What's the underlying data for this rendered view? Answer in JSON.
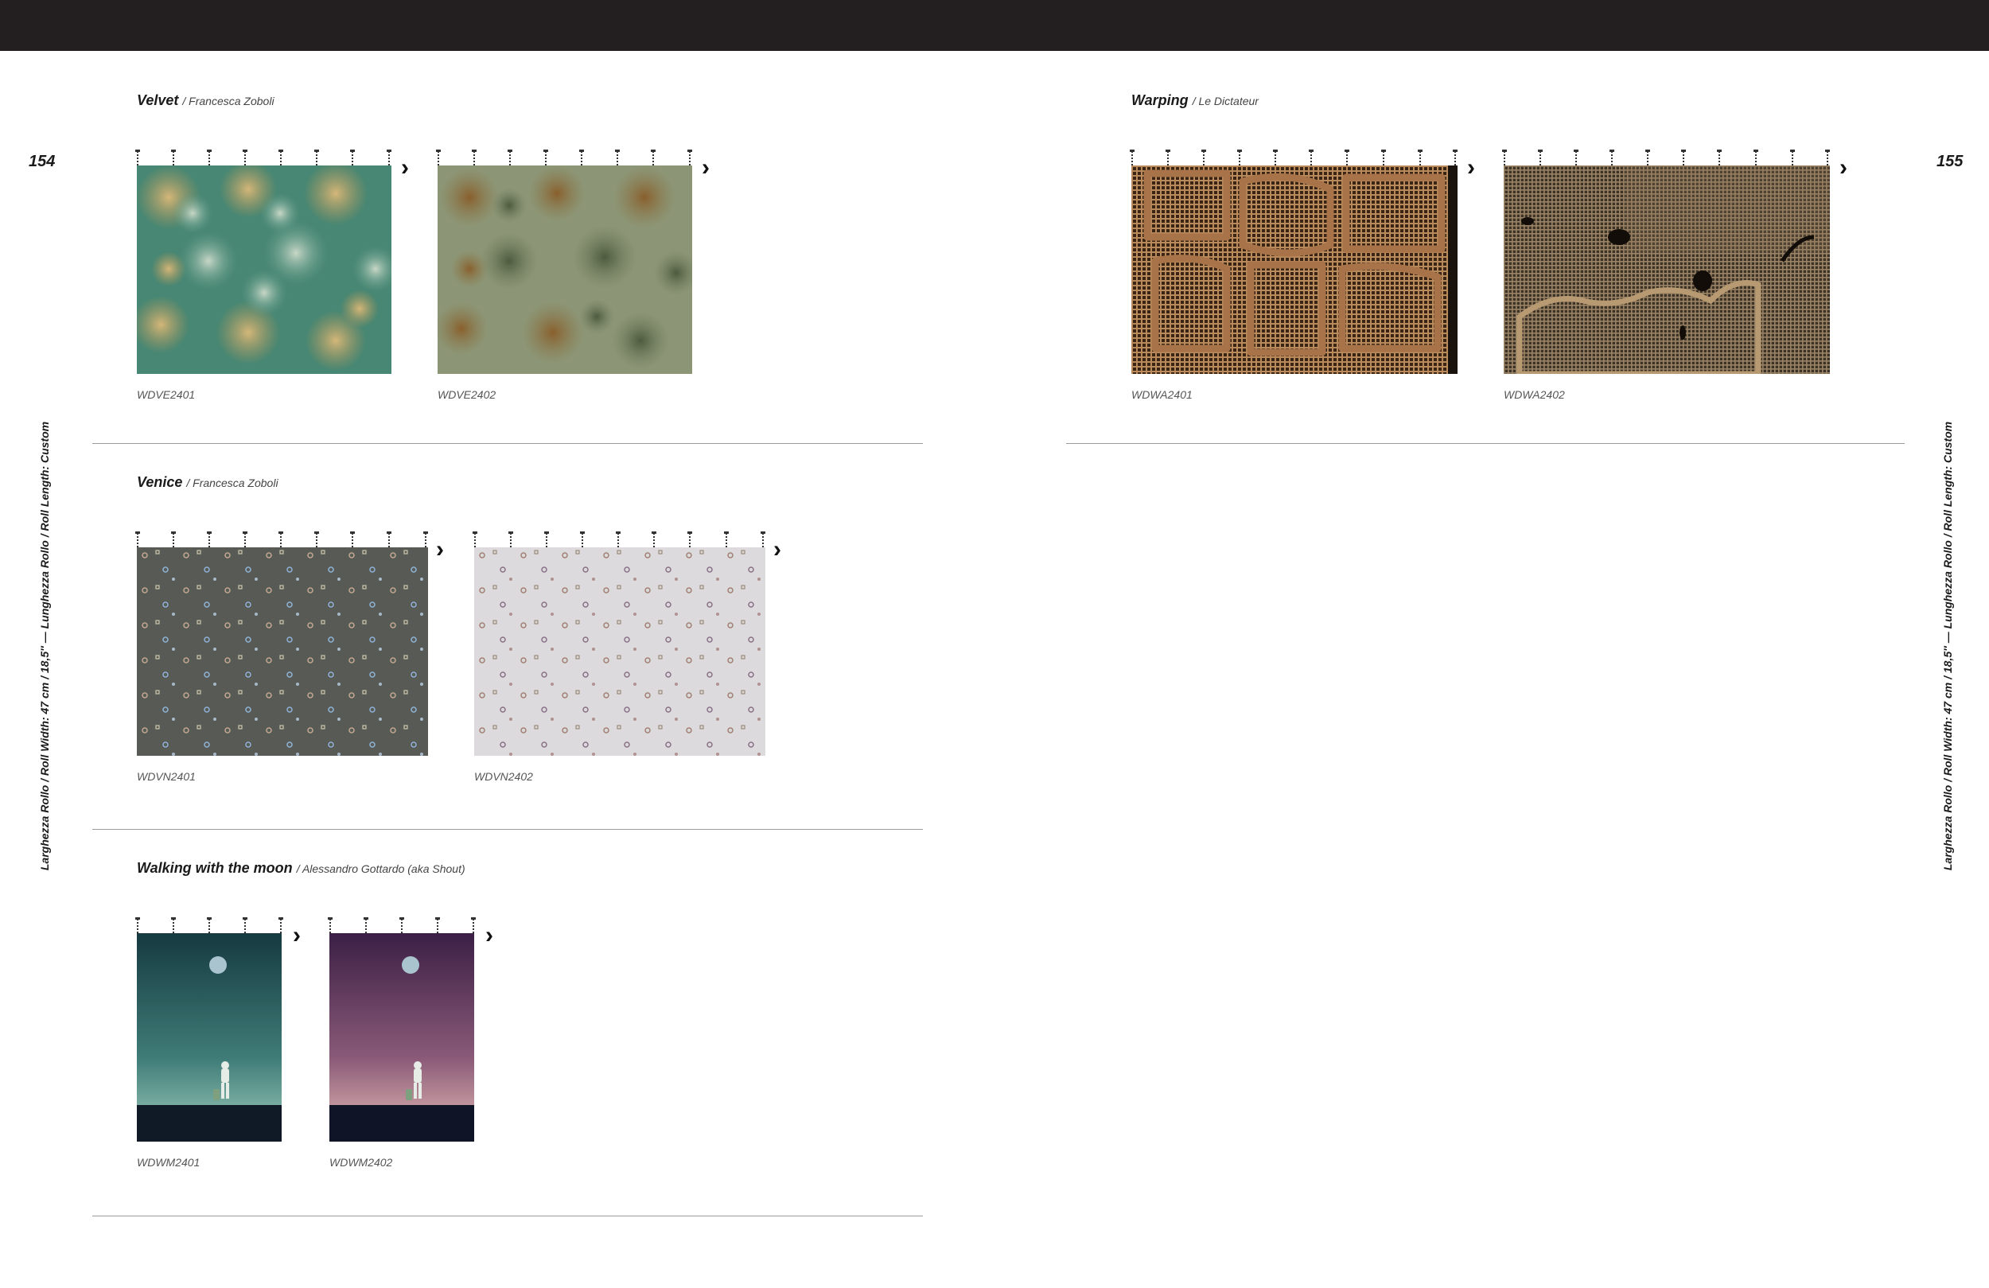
{
  "pages": {
    "left_number": "154",
    "right_number": "155"
  },
  "side_label": "Larghezza Rollo / Roll Width: 47 cm / 18,5″ — Lunghezza Rollo / Roll Length: Custom",
  "arrow_glyph": "›",
  "collections": [
    {
      "name": "Velvet",
      "author": "/ Francesca Zoboli",
      "samples": [
        {
          "code": "WDVE2401"
        },
        {
          "code": "WDVE2402"
        }
      ]
    },
    {
      "name": "Venice",
      "author": "/ Francesca Zoboli",
      "samples": [
        {
          "code": "WDVN2401"
        },
        {
          "code": "WDVN2402"
        }
      ]
    },
    {
      "name": "Walking with the moon",
      "author": "/ Alessandro Gottardo (aka Shout)",
      "samples": [
        {
          "code": "WDWM2401"
        },
        {
          "code": "WDWM2402"
        }
      ]
    },
    {
      "name": "Warping",
      "author": "/ Le Dictateur",
      "samples": [
        {
          "code": "WDWA2401"
        },
        {
          "code": "WDWA2402"
        }
      ]
    }
  ],
  "colors": {
    "topbar": "#231f20",
    "divider": "#9a9a9a"
  }
}
